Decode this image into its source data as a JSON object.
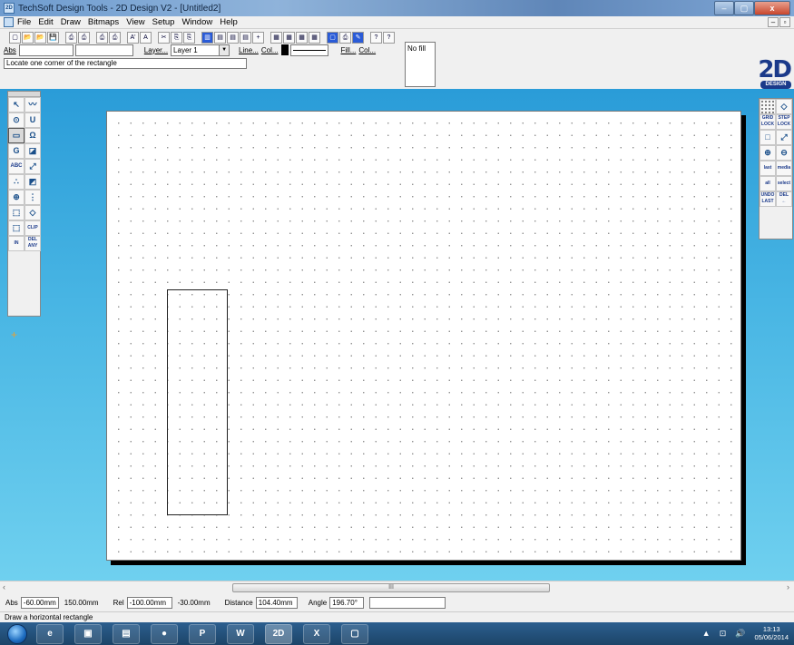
{
  "window": {
    "title": "TechSoft Design Tools - 2D Design V2 - [Untitled2]",
    "controls": {
      "minimize": "–",
      "maximize": "▢",
      "close": "x"
    },
    "app_icon_text": "2D"
  },
  "menu": {
    "items": [
      "File",
      "Edit",
      "Draw",
      "Bitmaps",
      "View",
      "Setup",
      "Window",
      "Help"
    ],
    "mdi_controls": [
      "–",
      "▫"
    ]
  },
  "toolbar": {
    "buttons": [
      "▢",
      "📂",
      "📂",
      "💾",
      "⎙",
      "⎙",
      "⎙",
      "⎙",
      "A'",
      "A",
      "✂",
      "⎘",
      "⎘",
      "▥",
      "▤",
      "▤",
      "▤",
      "+",
      "▦",
      "▦",
      "▦",
      "▦",
      "▢",
      "⎙",
      "✎",
      "?",
      "?"
    ],
    "abs_label": "Abs",
    "layer_label": "Layer...",
    "layer_value": "Layer 1",
    "line_label": "Line...",
    "col_label": "Col...",
    "fill_label": "Fill...",
    "fill_col_label": "Col...",
    "fill_value": "No fill"
  },
  "prompt": {
    "text": "Locate one corner of the rectangle"
  },
  "logo": {
    "big": "2D",
    "small": "DESIGN"
  },
  "left_tools": [
    "↖",
    "〰",
    "⊙",
    "U",
    "▭",
    "Ω",
    "G",
    "◪",
    "ABC",
    "⤢",
    "∴",
    "◩",
    "⊕",
    "⋮",
    "⬚",
    "◇",
    "⬚",
    "CLIP",
    "IN",
    "DEL ANY"
  ],
  "right_tools": [
    "",
    "◇",
    "GRID LOCK",
    "STEP LOCK",
    "□",
    "⤢",
    "⊕",
    "⊖",
    "last",
    "media",
    "all",
    "select",
    "UNDO LAST",
    "DEL ←"
  ],
  "scrollbar": {
    "left_arrow": "‹",
    "right_arrow": "›",
    "thumb_grip": "III"
  },
  "coords": {
    "abs_label": "Abs",
    "abs_x": "-60.00mm",
    "abs_y": "150.00mm",
    "rel_label": "Rel",
    "rel_x": "-100.00mm",
    "rel_y": "-30.00mm",
    "distance_label": "Distance",
    "distance": "104.40mm",
    "angle_label": "Angle",
    "angle": "196.70°"
  },
  "help": {
    "text": "Draw a horizontal rectangle"
  },
  "taskbar": {
    "apps": [
      "e",
      "▣",
      "▤",
      "●",
      "P",
      "W",
      "2D",
      "X",
      "▢"
    ],
    "tray_icons": [
      "▲",
      "⊡",
      "🔊"
    ],
    "time": "13:13",
    "date": "05/06/2014"
  },
  "colors": {
    "workspace_top": "#2a9cd8",
    "workspace_bottom": "#6fd0ef",
    "logo_blue": "#1b3a8a"
  }
}
